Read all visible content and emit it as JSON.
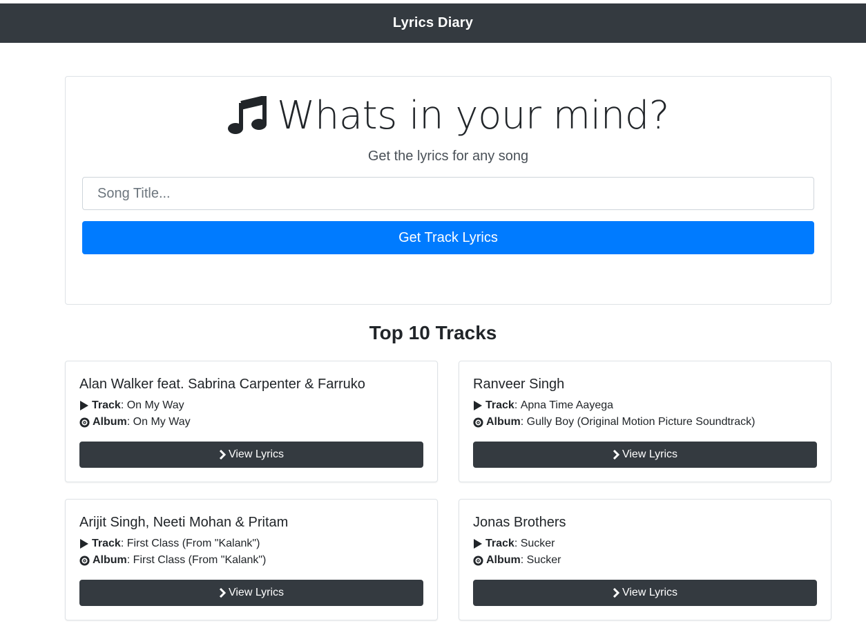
{
  "navbar": {
    "brand": "Lyrics Diary"
  },
  "search": {
    "title": "Whats in your mind?",
    "subtitle": "Get the lyrics for any song",
    "placeholder": "Song Title...",
    "button_label": "Get Track Lyrics",
    "icon": "music-note-icon"
  },
  "tracks_section": {
    "title": "Top 10 Tracks",
    "track_label": "Track",
    "album_label": "Album",
    "button_label": "View Lyrics",
    "items": [
      {
        "artist": "Alan Walker feat. Sabrina Carpenter & Farruko",
        "track": "On My Way",
        "album": "On My Way"
      },
      {
        "artist": "Ranveer Singh",
        "track": "Apna Time Aayega",
        "album": "Gully Boy (Original Motion Picture Soundtrack)"
      },
      {
        "artist": "Arijit Singh, Neeti Mohan & Pritam",
        "track": "First Class (From \"Kalank\")",
        "album": "First Class (From \"Kalank\")"
      },
      {
        "artist": "Jonas Brothers",
        "track": "Sucker",
        "album": "Sucker"
      }
    ]
  },
  "colors": {
    "navbar": "#343a40",
    "primary": "#007bff",
    "dark_button": "#343a40"
  }
}
